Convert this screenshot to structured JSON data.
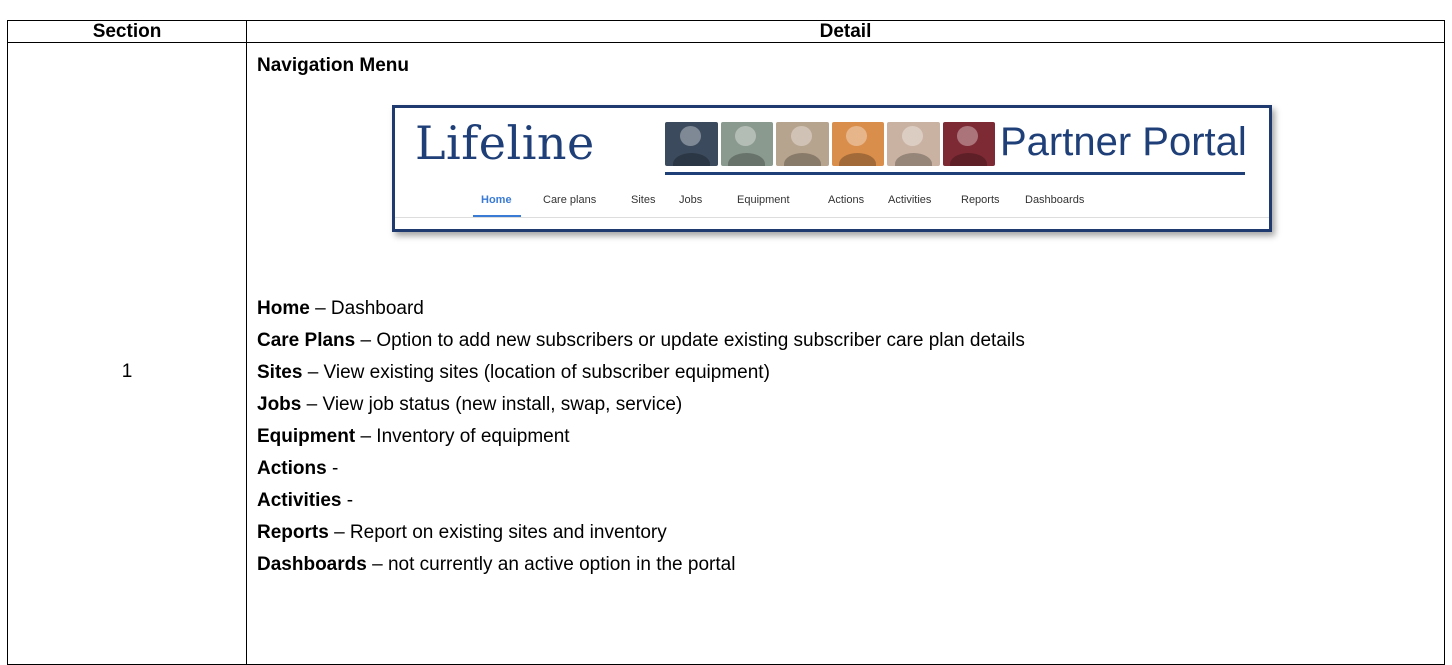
{
  "table": {
    "headers": {
      "section": "Section",
      "detail": "Detail"
    },
    "rows": [
      {
        "section": "1",
        "heading": "Navigation Menu",
        "banner": {
          "logo_text": "Lifeline",
          "portal_title": "Partner Portal",
          "photo_colors": [
            "#3b4a5c",
            "#8a9a8f",
            "#b7a48e",
            "#d98e4b",
            "#c9b2a2",
            "#7e2a34"
          ],
          "nav": [
            "Home",
            "Care plans",
            "Sites",
            "Jobs",
            "Equipment",
            "Actions",
            "Activities",
            "Reports",
            "Dashboards"
          ],
          "active_nav": "Home",
          "accent_color": "#3a7bd5",
          "brand_color": "#1f3f78"
        },
        "definitions": [
          {
            "term": "Home",
            "sep": " – ",
            "desc": "Dashboard"
          },
          {
            "term": "Care Plans",
            "sep": " – ",
            "desc": "Option to add new subscribers or update existing subscriber care plan details"
          },
          {
            "term": "Sites",
            "sep": " – ",
            "desc": "View existing sites (location of subscriber equipment)"
          },
          {
            "term": "Jobs",
            "sep": " – ",
            "desc": "View job status (new install, swap, service)"
          },
          {
            "term": "Equipment",
            "sep": " – ",
            "desc": "Inventory of equipment"
          },
          {
            "term": "Actions",
            "sep": " -",
            "desc": ""
          },
          {
            "term": "Activities",
            "sep": " -",
            "desc": ""
          },
          {
            "term": "Reports",
            "sep": " – ",
            "desc": "Report on existing sites and inventory"
          },
          {
            "term": "Dashboards",
            "sep": " – ",
            "desc": "not currently an active option in the portal"
          }
        ]
      }
    ]
  }
}
